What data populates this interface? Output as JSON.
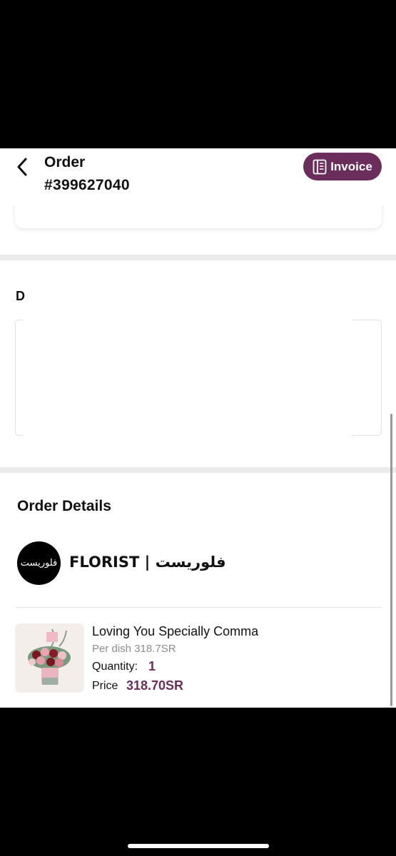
{
  "header": {
    "title_line1": "Order",
    "title_line2": "#399627040",
    "invoice_label": "Invoice"
  },
  "sections": {
    "partial_heading": "D",
    "order_details_title": "Order Details"
  },
  "store": {
    "name": "FLORIST | فلوريست",
    "logo_text": "فلوريست"
  },
  "product": {
    "name": "Loving You Specially Comma",
    "per_dish": "Per dish 318.7SR",
    "quantity_label": "Quantity:",
    "quantity": "1",
    "price_label": "Price",
    "price": "318.70SR"
  },
  "colors": {
    "accent": "#6b2d5c",
    "separator": "#ebebeb",
    "muted_text": "#8d8d8d"
  }
}
